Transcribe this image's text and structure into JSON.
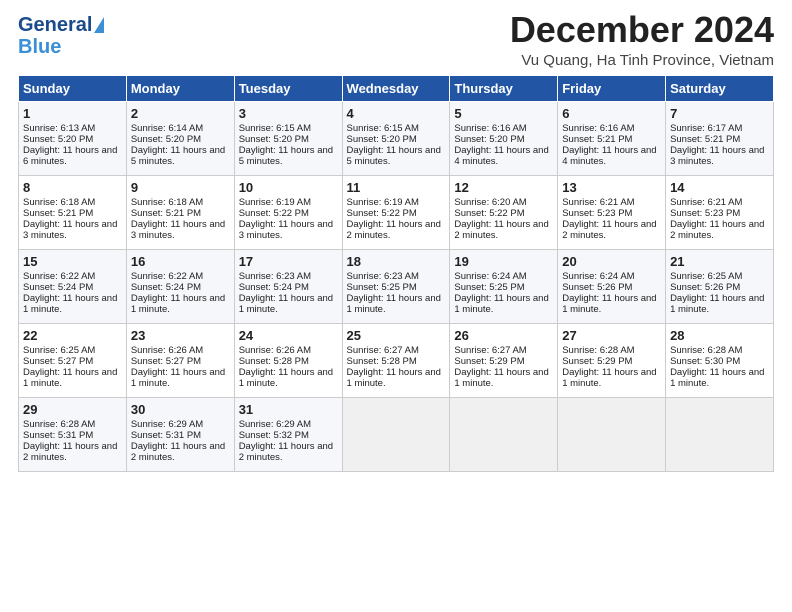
{
  "logo": {
    "line1": "General",
    "line2": "Blue"
  },
  "title": "December 2024",
  "location": "Vu Quang, Ha Tinh Province, Vietnam",
  "days_of_week": [
    "Sunday",
    "Monday",
    "Tuesday",
    "Wednesday",
    "Thursday",
    "Friday",
    "Saturday"
  ],
  "weeks": [
    [
      {
        "day": 1,
        "sunrise": "6:13 AM",
        "sunset": "5:20 PM",
        "daylight": "11 hours and 6 minutes."
      },
      {
        "day": 2,
        "sunrise": "6:14 AM",
        "sunset": "5:20 PM",
        "daylight": "11 hours and 5 minutes."
      },
      {
        "day": 3,
        "sunrise": "6:15 AM",
        "sunset": "5:20 PM",
        "daylight": "11 hours and 5 minutes."
      },
      {
        "day": 4,
        "sunrise": "6:15 AM",
        "sunset": "5:20 PM",
        "daylight": "11 hours and 5 minutes."
      },
      {
        "day": 5,
        "sunrise": "6:16 AM",
        "sunset": "5:20 PM",
        "daylight": "11 hours and 4 minutes."
      },
      {
        "day": 6,
        "sunrise": "6:16 AM",
        "sunset": "5:21 PM",
        "daylight": "11 hours and 4 minutes."
      },
      {
        "day": 7,
        "sunrise": "6:17 AM",
        "sunset": "5:21 PM",
        "daylight": "11 hours and 3 minutes."
      }
    ],
    [
      {
        "day": 8,
        "sunrise": "6:18 AM",
        "sunset": "5:21 PM",
        "daylight": "11 hours and 3 minutes."
      },
      {
        "day": 9,
        "sunrise": "6:18 AM",
        "sunset": "5:21 PM",
        "daylight": "11 hours and 3 minutes."
      },
      {
        "day": 10,
        "sunrise": "6:19 AM",
        "sunset": "5:22 PM",
        "daylight": "11 hours and 3 minutes."
      },
      {
        "day": 11,
        "sunrise": "6:19 AM",
        "sunset": "5:22 PM",
        "daylight": "11 hours and 2 minutes."
      },
      {
        "day": 12,
        "sunrise": "6:20 AM",
        "sunset": "5:22 PM",
        "daylight": "11 hours and 2 minutes."
      },
      {
        "day": 13,
        "sunrise": "6:21 AM",
        "sunset": "5:23 PM",
        "daylight": "11 hours and 2 minutes."
      },
      {
        "day": 14,
        "sunrise": "6:21 AM",
        "sunset": "5:23 PM",
        "daylight": "11 hours and 2 minutes."
      }
    ],
    [
      {
        "day": 15,
        "sunrise": "6:22 AM",
        "sunset": "5:24 PM",
        "daylight": "11 hours and 1 minute."
      },
      {
        "day": 16,
        "sunrise": "6:22 AM",
        "sunset": "5:24 PM",
        "daylight": "11 hours and 1 minute."
      },
      {
        "day": 17,
        "sunrise": "6:23 AM",
        "sunset": "5:24 PM",
        "daylight": "11 hours and 1 minute."
      },
      {
        "day": 18,
        "sunrise": "6:23 AM",
        "sunset": "5:25 PM",
        "daylight": "11 hours and 1 minute."
      },
      {
        "day": 19,
        "sunrise": "6:24 AM",
        "sunset": "5:25 PM",
        "daylight": "11 hours and 1 minute."
      },
      {
        "day": 20,
        "sunrise": "6:24 AM",
        "sunset": "5:26 PM",
        "daylight": "11 hours and 1 minute."
      },
      {
        "day": 21,
        "sunrise": "6:25 AM",
        "sunset": "5:26 PM",
        "daylight": "11 hours and 1 minute."
      }
    ],
    [
      {
        "day": 22,
        "sunrise": "6:25 AM",
        "sunset": "5:27 PM",
        "daylight": "11 hours and 1 minute."
      },
      {
        "day": 23,
        "sunrise": "6:26 AM",
        "sunset": "5:27 PM",
        "daylight": "11 hours and 1 minute."
      },
      {
        "day": 24,
        "sunrise": "6:26 AM",
        "sunset": "5:28 PM",
        "daylight": "11 hours and 1 minute."
      },
      {
        "day": 25,
        "sunrise": "6:27 AM",
        "sunset": "5:28 PM",
        "daylight": "11 hours and 1 minute."
      },
      {
        "day": 26,
        "sunrise": "6:27 AM",
        "sunset": "5:29 PM",
        "daylight": "11 hours and 1 minute."
      },
      {
        "day": 27,
        "sunrise": "6:28 AM",
        "sunset": "5:29 PM",
        "daylight": "11 hours and 1 minute."
      },
      {
        "day": 28,
        "sunrise": "6:28 AM",
        "sunset": "5:30 PM",
        "daylight": "11 hours and 1 minute."
      }
    ],
    [
      {
        "day": 29,
        "sunrise": "6:28 AM",
        "sunset": "5:31 PM",
        "daylight": "11 hours and 2 minutes."
      },
      {
        "day": 30,
        "sunrise": "6:29 AM",
        "sunset": "5:31 PM",
        "daylight": "11 hours and 2 minutes."
      },
      {
        "day": 31,
        "sunrise": "6:29 AM",
        "sunset": "5:32 PM",
        "daylight": "11 hours and 2 minutes."
      },
      null,
      null,
      null,
      null
    ]
  ]
}
